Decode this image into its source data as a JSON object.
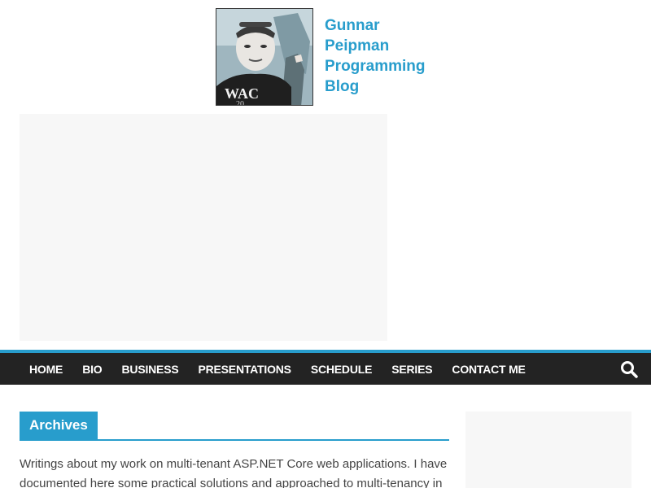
{
  "header": {
    "site_title": "Gunnar Peipman Programming Blog",
    "logo_alt": "Gunnar Peipman"
  },
  "nav": {
    "items": [
      {
        "label": "HOME"
      },
      {
        "label": "BIO"
      },
      {
        "label": "BUSINESS"
      },
      {
        "label": "PRESENTATIONS"
      },
      {
        "label": "SCHEDULE"
      },
      {
        "label": "SERIES"
      },
      {
        "label": "CONTACT ME"
      }
    ],
    "search_icon": "search-icon"
  },
  "main": {
    "archive_title": "Archives",
    "archive_description": "Writings about my work on multi-tenant ASP.NET Core web applications. I have documented here some practical solutions and approached to multi-tenancy in"
  },
  "colors": {
    "accent": "#289dcc",
    "nav_background": "#232323",
    "placeholder_background": "#f7f7f7"
  }
}
